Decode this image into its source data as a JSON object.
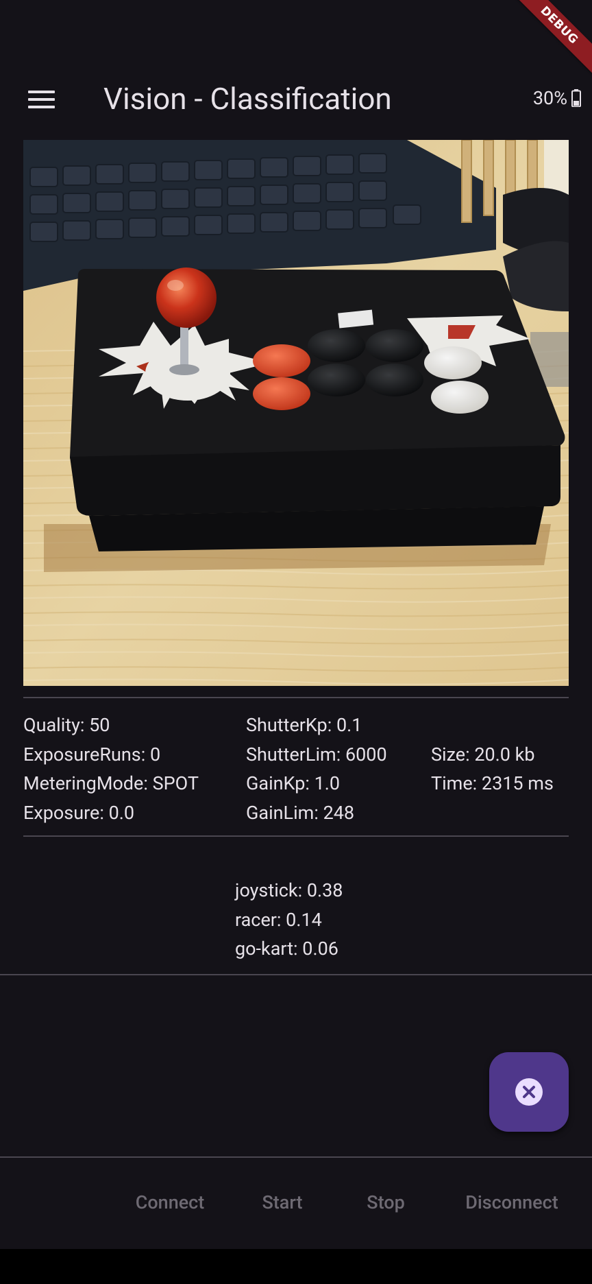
{
  "debug_banner": "DEBUG",
  "app_bar": {
    "title": "Vision - Classification",
    "battery": "30%"
  },
  "settings": {
    "col1": [
      "Quality: 50",
      "ExposureRuns: 0",
      "MeteringMode: SPOT",
      "Exposure: 0.0"
    ],
    "col2": [
      "ShutterKp: 0.1",
      "ShutterLim: 6000",
      "GainKp: 1.0",
      "GainLim: 248"
    ],
    "col3": [
      "",
      "Size: 20.0 kb",
      "Time: 2315 ms",
      ""
    ]
  },
  "predictions": [
    "joystick: 0.38",
    "racer: 0.14",
    "go-kart: 0.06"
  ],
  "actions": {
    "connect": "Connect",
    "start": "Start",
    "stop": "Stop",
    "disconnect": "Disconnect"
  },
  "colors": {
    "background": "#141218",
    "fab": "#4f378b",
    "disabled_text": "#6e6a73",
    "debug_banner": "#8e1d22"
  }
}
